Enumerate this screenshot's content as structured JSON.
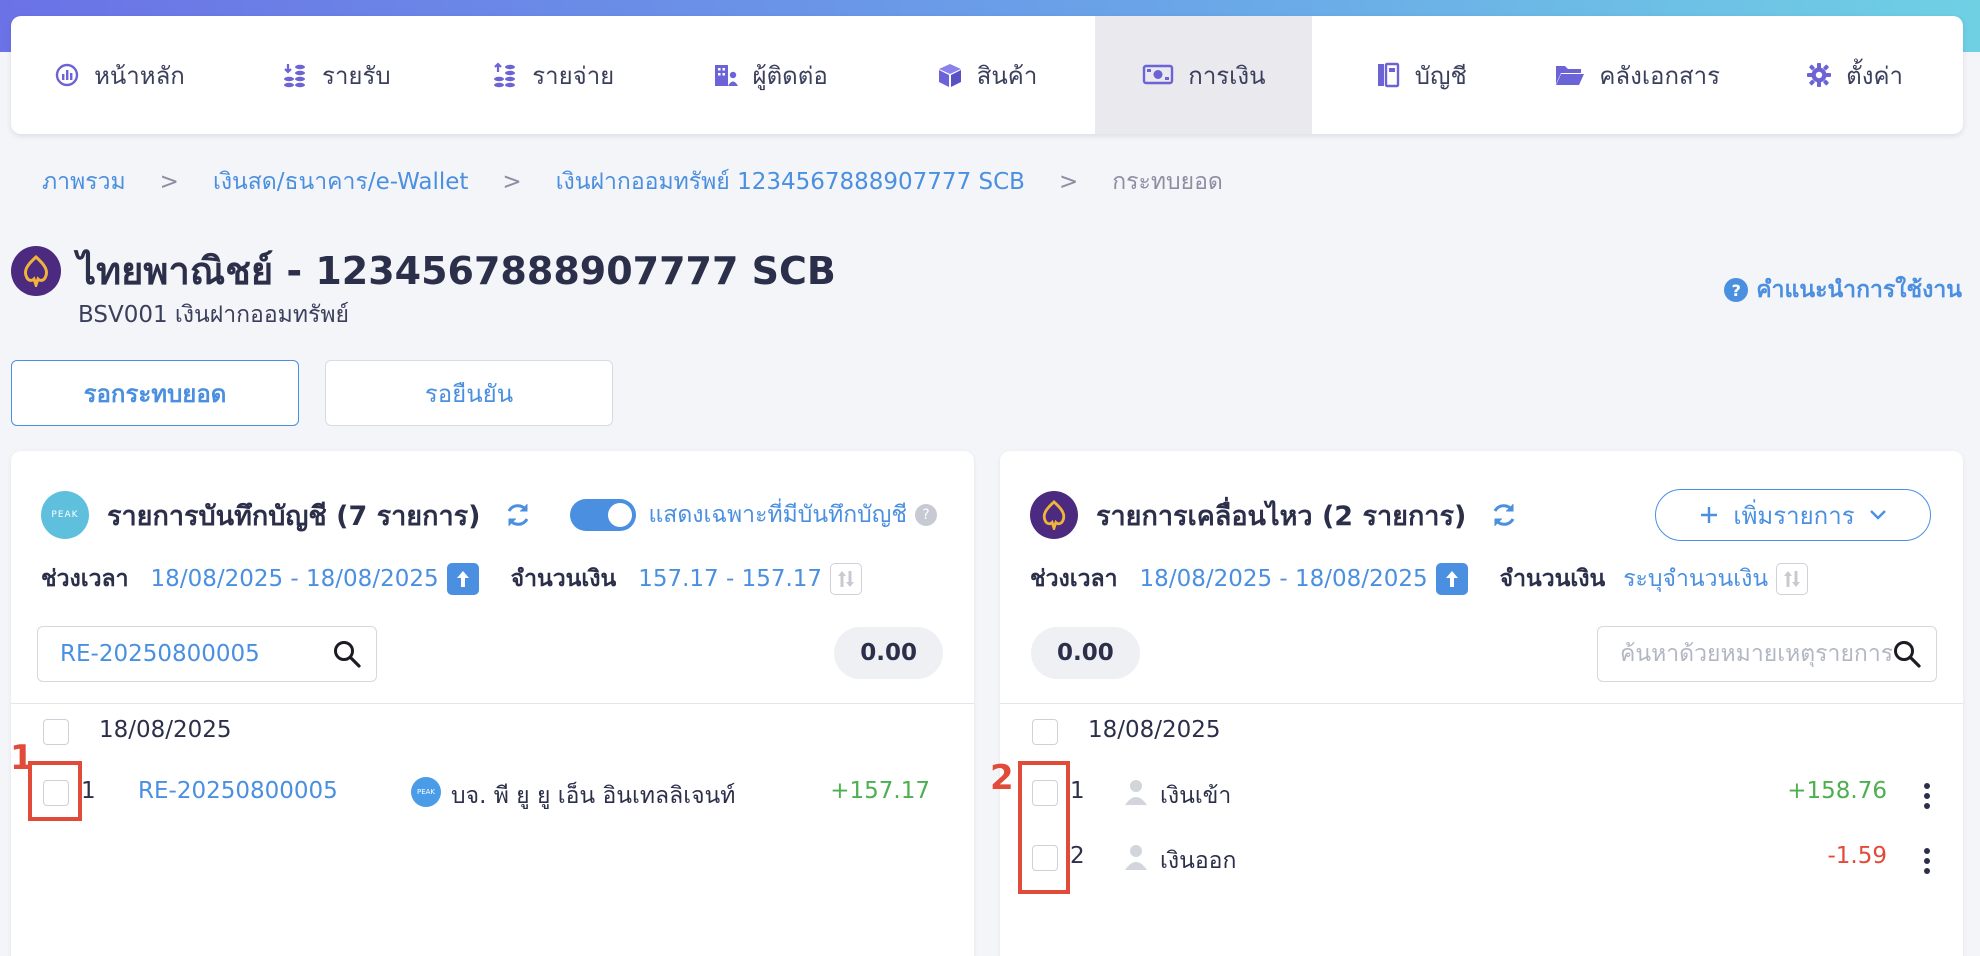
{
  "nav": {
    "items": [
      {
        "label": "หน้าหลัก",
        "icon": "dashboard-icon"
      },
      {
        "label": "รายรับ",
        "icon": "income-icon"
      },
      {
        "label": "รายจ่าย",
        "icon": "expense-icon"
      },
      {
        "label": "ผู้ติดต่อ",
        "icon": "contacts-icon"
      },
      {
        "label": "สินค้า",
        "icon": "box-icon"
      },
      {
        "label": "การเงิน",
        "icon": "money-icon"
      },
      {
        "label": "บัญชี",
        "icon": "ledger-icon"
      },
      {
        "label": "คลังเอกสาร",
        "icon": "folder-icon"
      },
      {
        "label": "ตั้งค่า",
        "icon": "gear-icon"
      }
    ],
    "active_index": 5
  },
  "breadcrumb": {
    "items": [
      "ภาพรวม",
      "เงินสด/ธนาคาร/e-Wallet",
      "เงินฝากออมทรัพย์ 1234567888907777 SCB",
      "กระทบยอด"
    ],
    "separator": ">"
  },
  "page": {
    "title": "ไทยพาณิชย์ - 1234567888907777 SCB",
    "subtitle": "BSV001 เงินฝากออมทรัพย์",
    "help_label": "คำแนะนำการใช้งาน",
    "help_mark": "?"
  },
  "tabs": [
    {
      "label": "รอกระทบยอด",
      "active": true
    },
    {
      "label": "รอยืนยัน",
      "active": false
    }
  ],
  "left_panel": {
    "logo_text": "PEAK",
    "title": "รายการบันทึกบัญชี (7 รายการ)",
    "toggle_label": "แสดงเฉพาะที่มีบันทึกบัญชี",
    "toggle_on": true,
    "help_mark": "?",
    "filter": {
      "period_label": "ช่วงเวลา",
      "period_value": "18/08/2025 - 18/08/2025",
      "amount_label": "จำนวนเงิน",
      "amount_value": "157.17 - 157.17"
    },
    "search_value": "RE-20250800005",
    "total": "0.00",
    "group_date": "18/08/2025",
    "rows": [
      {
        "index": "1",
        "doc": "RE-20250800005",
        "party_logo": "PEAK",
        "party": "บจ. พี ยู ยู เอ็น อินเทลลิเจนท์",
        "amount": "+157.17"
      }
    ]
  },
  "right_panel": {
    "title": "รายการเคลื่อนไหว (2 รายการ)",
    "add_label": "เพิ่มรายการ",
    "filter": {
      "period_label": "ช่วงเวลา",
      "period_value": "18/08/2025 - 18/08/2025",
      "amount_label": "จำนวนเงิน",
      "amount_value": "ระบุจำนวนเงิน"
    },
    "total": "0.00",
    "search_placeholder": "ค้นหาด้วยหมายเหตุรายการเค",
    "group_date": "18/08/2025",
    "rows": [
      {
        "index": "1",
        "desc": "เงินเข้า",
        "amount": "+158.76",
        "sign": "pos"
      },
      {
        "index": "2",
        "desc": "เงินออก",
        "amount": "-1.59",
        "sign": "neg"
      }
    ]
  },
  "annotations": [
    {
      "number": "1"
    },
    {
      "number": "2"
    }
  ],
  "colors": {
    "accent": "#4a8fe0",
    "positive": "#4caf50",
    "negative": "#e04b3a",
    "bank_purple": "#4b2a7f",
    "bank_gold": "#f0b43a"
  }
}
